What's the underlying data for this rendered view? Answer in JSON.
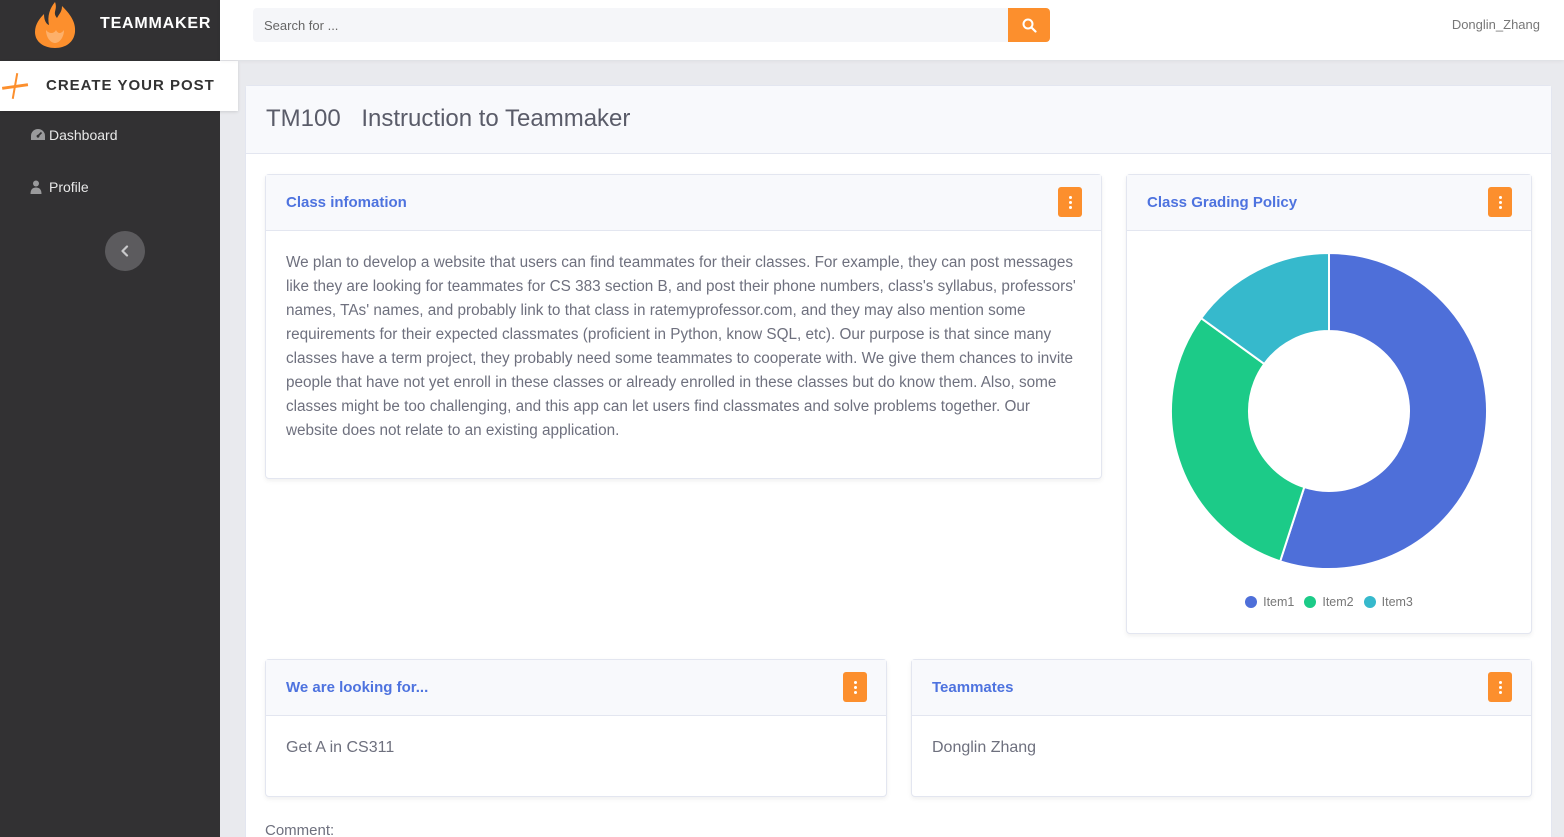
{
  "brand": {
    "name": "TEAMMAKER",
    "logo_icon": "flame-icon",
    "logo_color": "#fc8f2d"
  },
  "sidebar": {
    "create_post_label": "CREATE YOUR POST",
    "items": [
      {
        "label": "Dashboard",
        "icon": "tachometer-icon"
      },
      {
        "label": "Profile",
        "icon": "user-icon"
      }
    ],
    "collapse_icon": "chevron-left-icon"
  },
  "topbar": {
    "search_placeholder": "Search for ...",
    "search_icon": "search-icon",
    "username": "Donglin_Zhang"
  },
  "page": {
    "course_code": "TM100",
    "course_title": "Instruction to Teammaker"
  },
  "cards": {
    "class_info": {
      "title": "Class infomation",
      "body": "We plan to develop a website that users can find teammates for their classes. For example, they can post messages like they are looking for teammates for CS 383 section B, and post their phone numbers, class's syllabus, professors' names, TAs' names, and probably link to that class in ratemyprofessor.com, and they may also mention some requirements for their expected classmates (proficient in Python, know SQL, etc). Our purpose is that since many classes have a term project, they probably need some teammates to cooperate with. We give them chances to invite people that have not yet enroll in these classes or already enrolled in these classes but do know them. Also, some classes might be too challenging, and this app can let users find classmates and solve problems together. Our website does not relate to an existing application."
    },
    "grading": {
      "title": "Class Grading Policy"
    },
    "looking_for": {
      "title": "We are looking for...",
      "body": "Get A in CS311"
    },
    "teammates": {
      "title": "Teammates",
      "body": "Donglin Zhang"
    }
  },
  "comment_label": "Comment:",
  "colors": {
    "accent": "#fc8f2d",
    "primary": "#4e73df",
    "sidebar_bg": "#323133"
  },
  "chart_data": {
    "type": "pie",
    "title": "",
    "categories": [
      "Item1",
      "Item2",
      "Item3"
    ],
    "values": [
      55,
      30,
      15
    ],
    "colors": [
      "#4e6fd9",
      "#1ccb88",
      "#36b9cc"
    ],
    "donut": true,
    "legend_position": "bottom"
  }
}
